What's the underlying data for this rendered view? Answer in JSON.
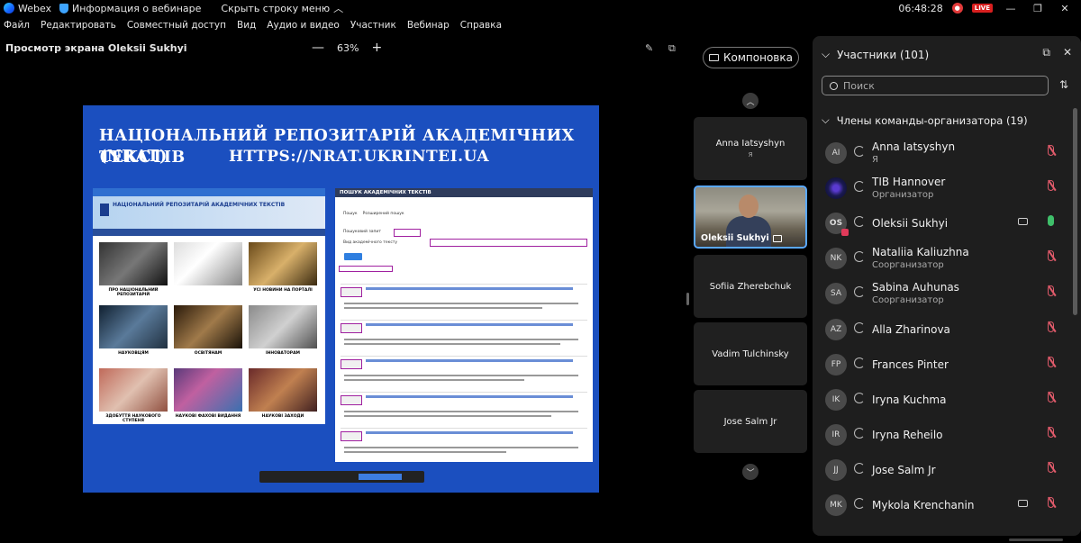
{
  "titlebar": {
    "app_name": "Webex",
    "webinar_info": "Информация о вебинаре",
    "hide_menu": "Скрыть строку меню",
    "hide_chevron": "︿",
    "clock": "06:48:28",
    "live_badge": "LIVE",
    "minimize": "—",
    "restore": "❐",
    "close": "✕"
  },
  "menu": [
    "Файл",
    "Редактировать",
    "Совместный доступ",
    "Вид",
    "Аудио и видео",
    "Участник",
    "Вебинар",
    "Справка"
  ],
  "share": {
    "title": "Просмотр экрана Oleksii Sukhyi",
    "zoom_minus": "—",
    "zoom_level": "63%",
    "zoom_plus": "+",
    "annotate_icon": "✎",
    "popout_icon": "⧉"
  },
  "slide": {
    "heading": "НАЦІОНАЛЬНИЙ РЕПОЗИТАРІЙ АКАДЕМІЧНИХ ТЕКСТІВ",
    "acronym": "(NRAT)",
    "url": "HTTPS://NRAT.UKRINTEI.UA",
    "left_site_name": "НАЦІОНАЛЬНИЙ РЕПОЗИТАРІЙ АКАДЕМІЧНИХ ТЕКСТІВ",
    "tiles": [
      "ПРО НАЦІОНАЛЬНИЙ РЕПОЗИТАРІЙ",
      "",
      "УСІ НОВИНИ НА ПОРТАЛІ",
      "НАУКОВЦЯМ",
      "ОСВІТЯНАМ",
      "ІННОВАТОРАМ",
      "ЗДОБУТТЯ НАУКОВОГО СТУПЕНЯ",
      "НАУКОВІ ФАХОВІ ВИДАННЯ",
      "НАУКОВІ ЗАХОДИ"
    ],
    "right_header": "ПОШУК АКАДЕМІЧНИХ ТЕКСТІВ",
    "tab_search": "Пошук",
    "tab_advanced": "Розширений пошук",
    "query_label": "Пошуковий запит",
    "type_label": "Вид академічного тексту"
  },
  "layout_button": "Компоновка",
  "videos": [
    {
      "name": "Anna Iatsyshyn",
      "role": "Я"
    },
    {
      "name": "Oleksii Sukhyi",
      "role": ""
    },
    {
      "name": "Sofiia Zherebchuk",
      "role": ""
    },
    {
      "name": "Vadim Tulchinsky",
      "role": ""
    },
    {
      "name": "Jose Salm Jr",
      "role": ""
    }
  ],
  "strip_up": "︿",
  "strip_down": "﹀",
  "participants": {
    "title": "Участники (101)",
    "popout": "⧉",
    "close": "✕",
    "search_placeholder": "Поиск",
    "sort_icon": "⇅",
    "group_title": "Члены команды-организатора (19)",
    "chevron": "⌵",
    "list": [
      {
        "initials": "AI",
        "name": "Anna Iatsyshyn",
        "role": "Я",
        "camera": false,
        "mic_on": false
      },
      {
        "initials": "",
        "name": "TIB Hannover",
        "role": "Организатор",
        "camera": false,
        "mic_on": false
      },
      {
        "initials": "OS",
        "name": "Oleksii Sukhyi",
        "role": "",
        "camera": true,
        "mic_on": true
      },
      {
        "initials": "NK",
        "name": "Nataliia Kaliuzhna",
        "role": "Соорганизатор",
        "camera": false,
        "mic_on": false
      },
      {
        "initials": "SA",
        "name": "Sabina Auhunas",
        "role": "Соорганизатор",
        "camera": false,
        "mic_on": false
      },
      {
        "initials": "AZ",
        "name": "Alla Zharinova",
        "role": "",
        "camera": false,
        "mic_on": false
      },
      {
        "initials": "FP",
        "name": "Frances Pinter",
        "role": "",
        "camera": false,
        "mic_on": false
      },
      {
        "initials": "IK",
        "name": "Iryna Kuchma",
        "role": "",
        "camera": false,
        "mic_on": false
      },
      {
        "initials": "IR",
        "name": "Iryna Reheilo",
        "role": "",
        "camera": false,
        "mic_on": false
      },
      {
        "initials": "JJ",
        "name": "Jose Salm Jr",
        "role": "",
        "camera": false,
        "mic_on": false
      },
      {
        "initials": "MK",
        "name": "Mykola Krenchanin",
        "role": "",
        "camera": true,
        "mic_on": false
      }
    ]
  }
}
